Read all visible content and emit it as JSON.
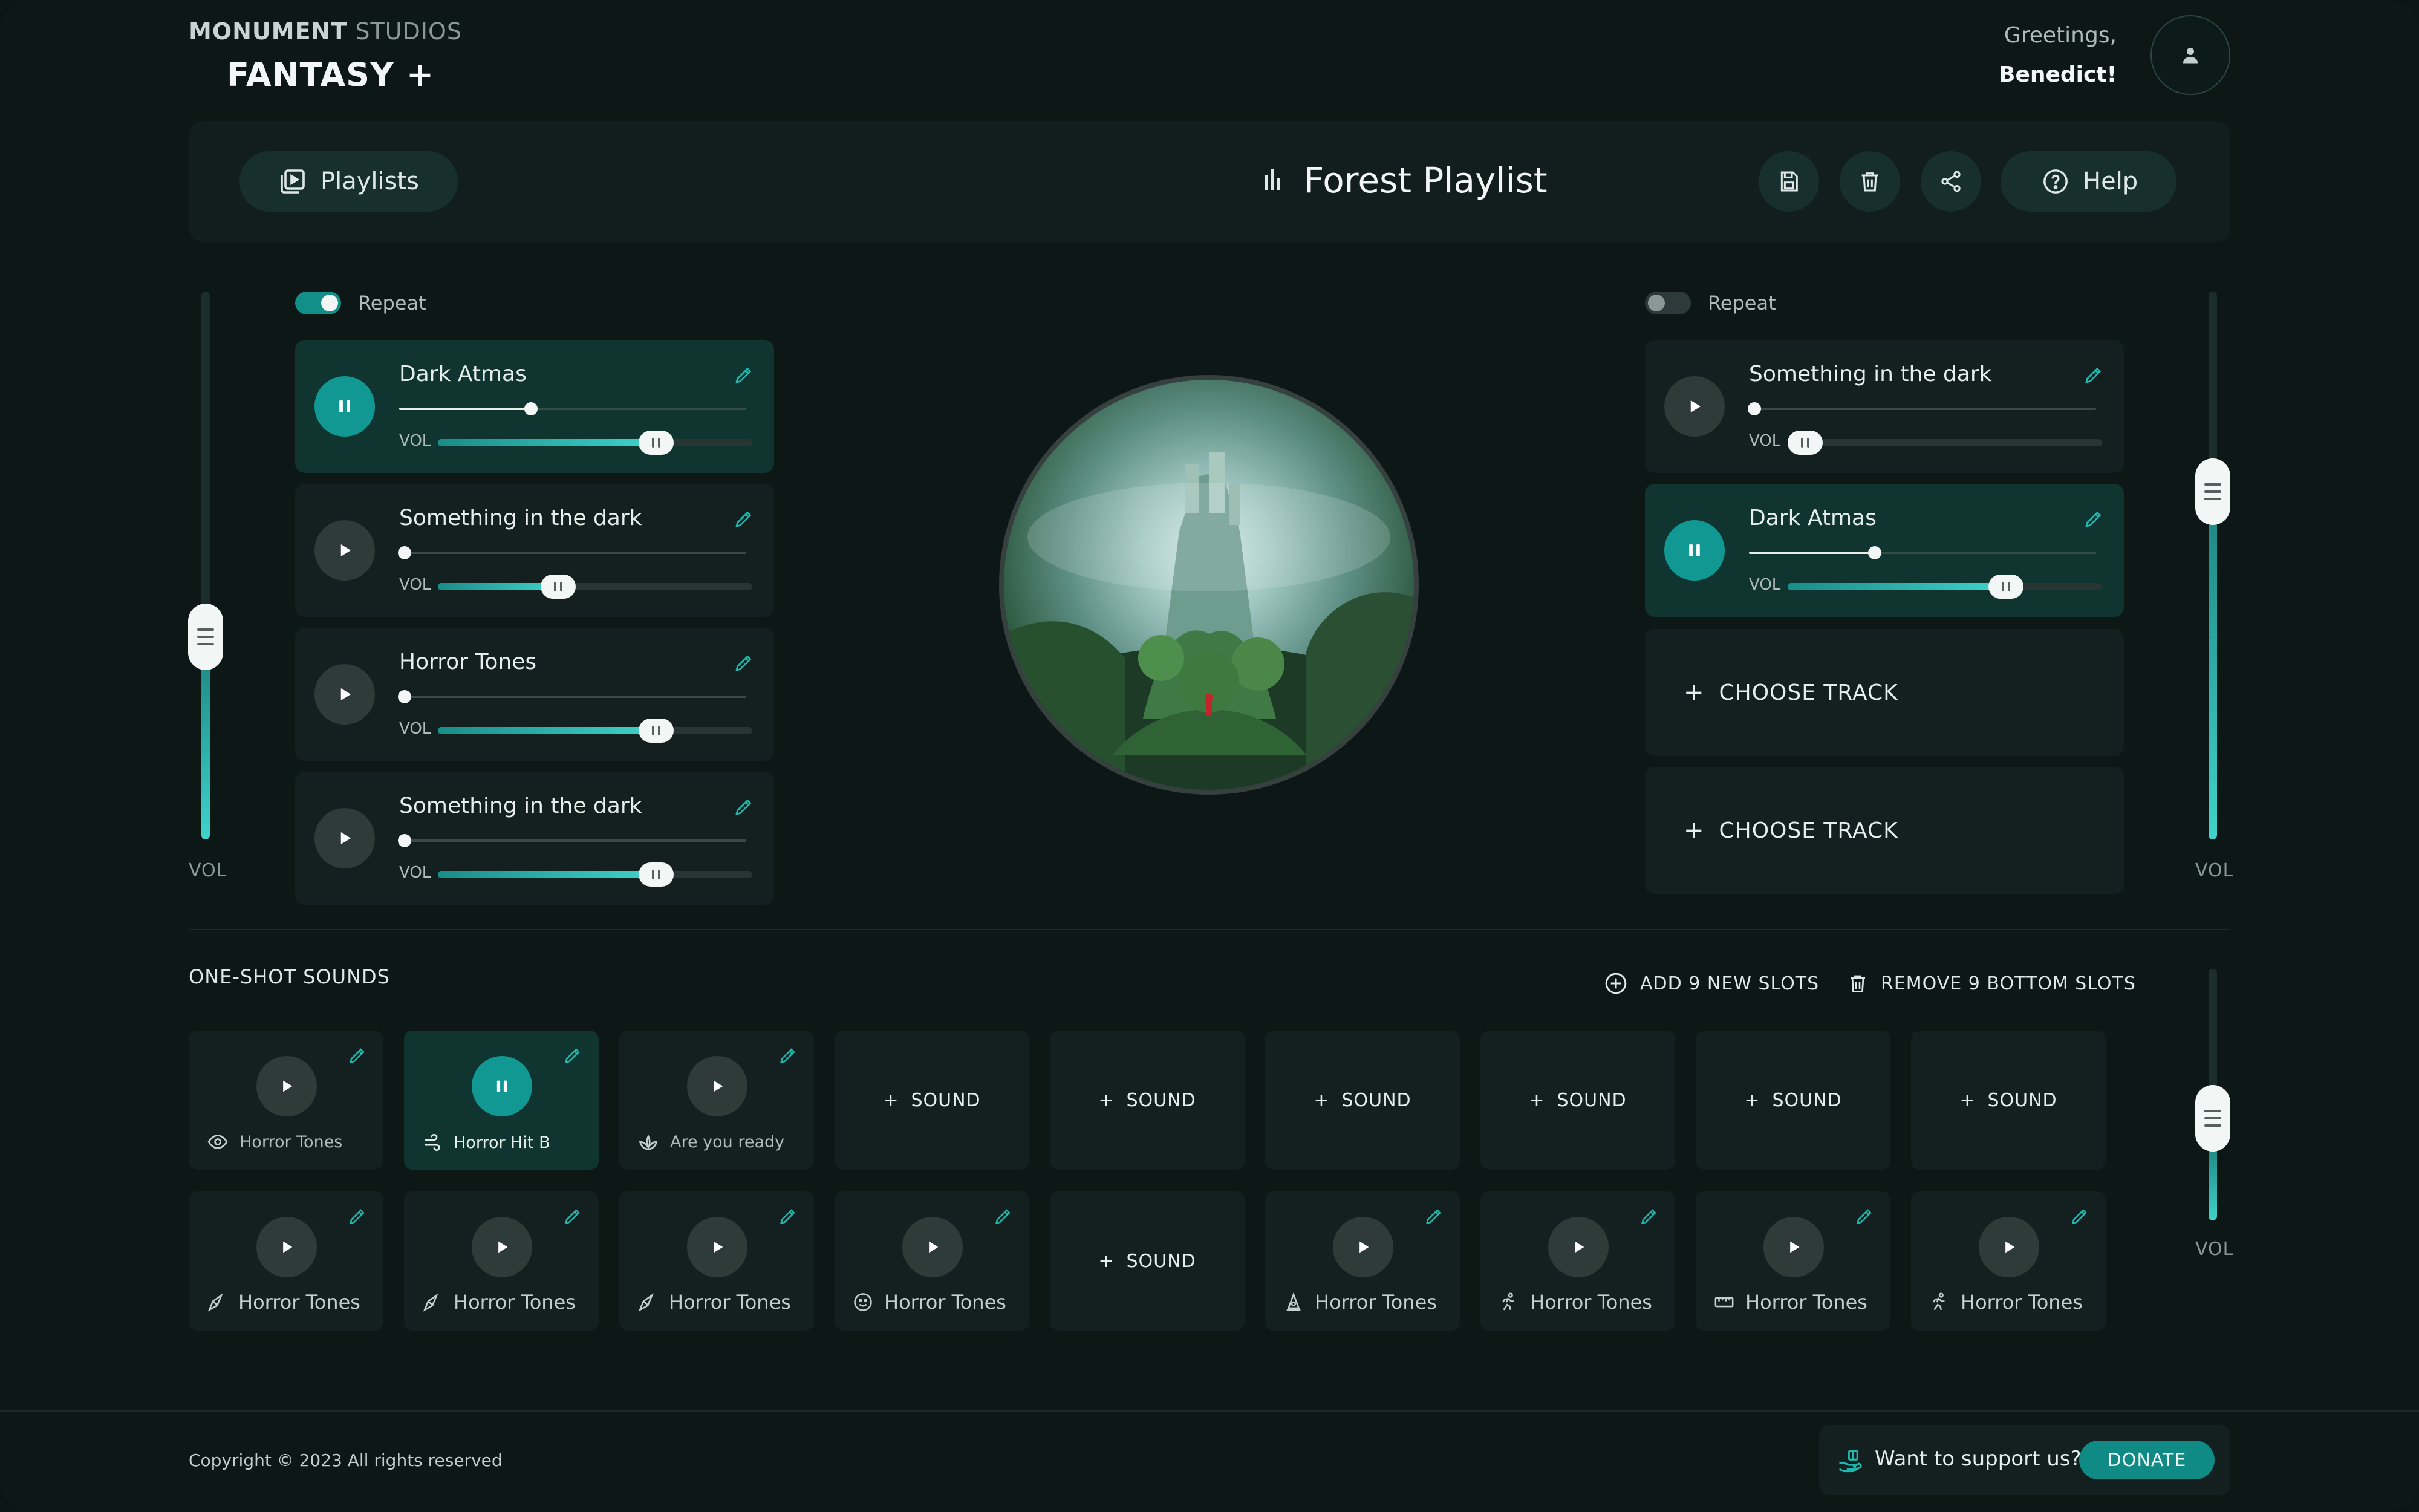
{
  "brand": {
    "company_prefix": "MONUMENT",
    "company_suffix": "STUDIOS",
    "product": "FANTASY +"
  },
  "user": {
    "greeting": "Greetings,",
    "name": "Benedict!"
  },
  "toolbar": {
    "playlists_label": "Playlists",
    "playlist_title": "Forest Playlist",
    "help_label": "Help"
  },
  "left_deck": {
    "repeat_label": "Repeat",
    "repeat_on": true,
    "vol_label": "VOL",
    "master_volume": 0.38,
    "tracks": [
      {
        "name": "Dark Atmas",
        "playing": true,
        "progress": 0.38,
        "volume": 0.69
      },
      {
        "name": "Something in the dark",
        "playing": false,
        "progress": 0.0,
        "volume": 0.38
      },
      {
        "name": "Horror Tones",
        "playing": false,
        "progress": 0.0,
        "volume": 0.69
      },
      {
        "name": "Something in the dark",
        "playing": false,
        "progress": 0.0,
        "volume": 0.69
      }
    ]
  },
  "right_deck": {
    "repeat_label": "Repeat",
    "repeat_on": false,
    "vol_label": "VOL",
    "master_volume": 0.68,
    "tracks": [
      {
        "name": "Something in the dark",
        "playing": false,
        "progress": 0.0,
        "volume": 0.05
      },
      {
        "name": "Dark Atmas",
        "playing": true,
        "progress": 0.36,
        "volume": 0.69
      }
    ],
    "choose_label": "CHOOSE TRACK"
  },
  "one_shot": {
    "title": "ONE-SHOT SOUNDS",
    "add_slots_label": "ADD 9 NEW SLOTS",
    "remove_slots_label": "REMOVE 9 BOTTOM SLOTS",
    "vol_label": "VOL",
    "volume": 0.33,
    "add_sound_label": "SOUND",
    "row1": [
      {
        "name": "Horror Tones",
        "icon": "eye-icon",
        "playing": false
      },
      {
        "name": "Horror Hit B",
        "icon": "wind-icon",
        "playing": true
      },
      {
        "name": "Are you ready",
        "icon": "lotus-icon",
        "playing": false
      },
      null,
      null,
      null,
      null,
      null,
      null
    ],
    "row2": [
      {
        "name": "Horror Tones",
        "icon": "horn-icon"
      },
      {
        "name": "Horror Tones",
        "icon": "horn-icon"
      },
      {
        "name": "Horror Tones",
        "icon": "horn-icon"
      },
      {
        "name": "Horror Tones",
        "icon": "smile-icon"
      },
      null,
      {
        "name": "Horror Tones",
        "icon": "bell-icon"
      },
      {
        "name": "Horror Tones",
        "icon": "runner-icon"
      },
      {
        "name": "Horror Tones",
        "icon": "ruler-icon"
      },
      {
        "name": "Horror Tones",
        "icon": "runner-icon"
      }
    ]
  },
  "footer": {
    "copyright": "Copyright © 2023 All rights reserved",
    "support_text": "Want to support us?",
    "donate_label": "DONATE"
  },
  "colors": {
    "accent": "#129893",
    "background": "#0c1716",
    "panel": "#14201f"
  }
}
